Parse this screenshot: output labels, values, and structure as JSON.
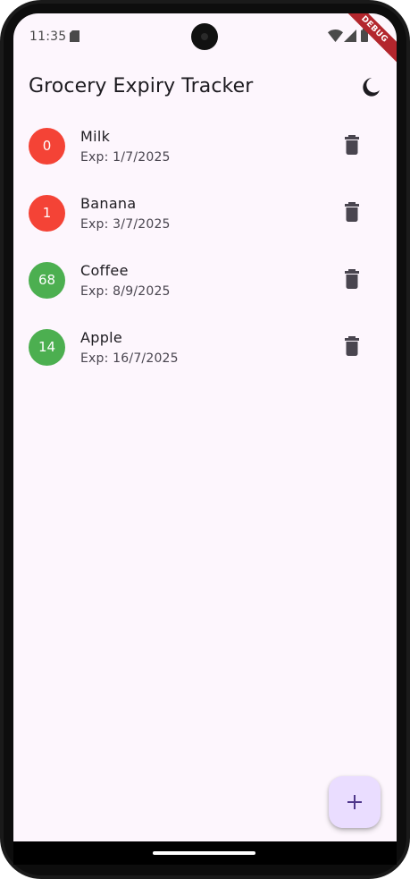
{
  "status_bar": {
    "time": "11:35",
    "icons": [
      "sd-card-icon",
      "wifi-icon",
      "cell-signal-icon",
      "battery-icon"
    ]
  },
  "debug_banner": "DEBUG",
  "app_bar": {
    "title": "Grocery Expiry Tracker",
    "action_icon": "dark-mode-moon-icon"
  },
  "items": [
    {
      "days": "0",
      "name": "Milk",
      "expiry": "Exp: 1/7/2025",
      "status": "expired",
      "color": "#f44336"
    },
    {
      "days": "1",
      "name": "Banana",
      "expiry": "Exp: 3/7/2025",
      "status": "soon",
      "color": "#f44336"
    },
    {
      "days": "68",
      "name": "Coffee",
      "expiry": "Exp: 8/9/2025",
      "status": "ok",
      "color": "#4caf50"
    },
    {
      "days": "14",
      "name": "Apple",
      "expiry": "Exp: 16/7/2025",
      "status": "ok",
      "color": "#4caf50"
    }
  ],
  "fab": {
    "icon": "add-icon",
    "label": "+"
  },
  "colors": {
    "background": "#fdf6fd",
    "fab": "#eaddff",
    "fab_icon": "#4f378b",
    "expired": "#f44336",
    "ok": "#4caf50",
    "text_primary": "#1d1b20",
    "text_secondary": "#49454f",
    "icon": "#49454f"
  }
}
